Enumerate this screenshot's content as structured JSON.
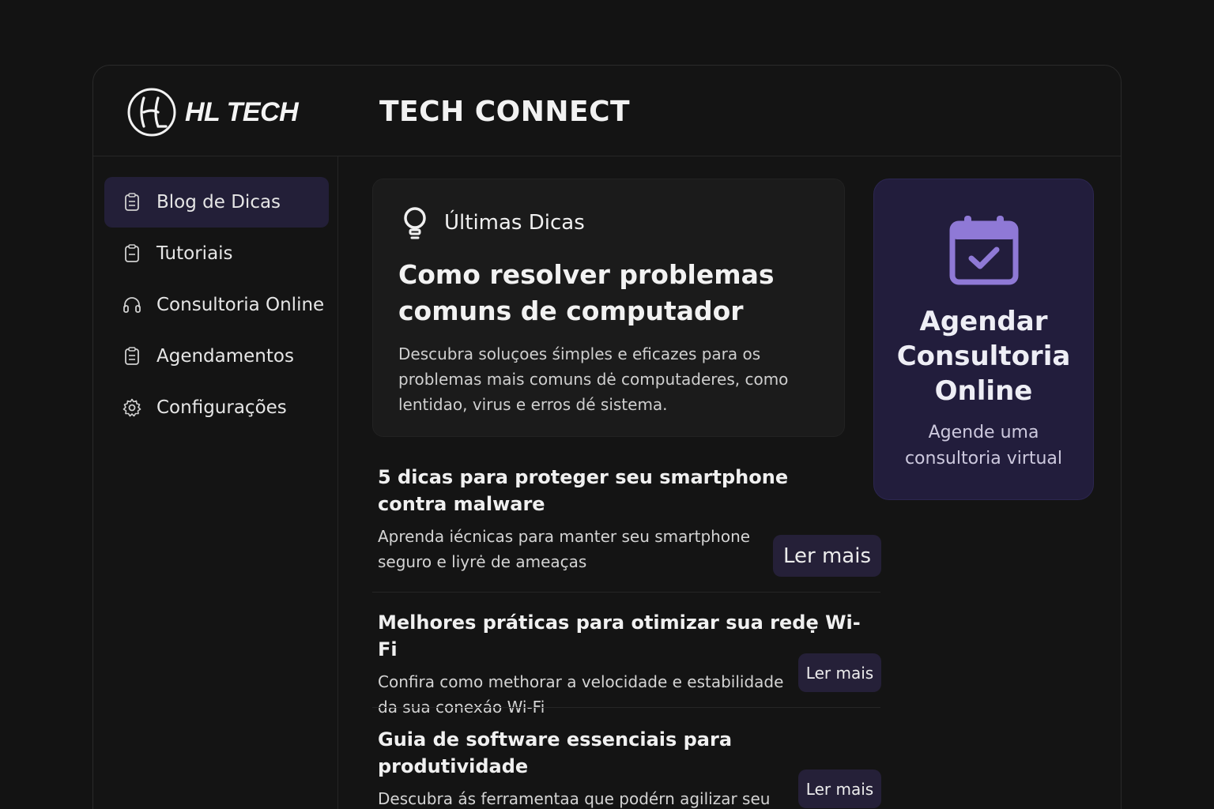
{
  "brand": {
    "name": "HL TECH",
    "monogram": "HL"
  },
  "app_title": "TECH CONNECT",
  "sidebar": {
    "items": [
      {
        "label": "Blog de Dicas",
        "icon": "clipboard-icon",
        "active": true
      },
      {
        "label": "Tutoriais",
        "icon": "clipboard-icon",
        "active": false
      },
      {
        "label": "Consultoria Online",
        "icon": "headset-icon",
        "active": false
      },
      {
        "label": "Agendamentos",
        "icon": "clipboard-icon",
        "active": false
      },
      {
        "label": "Configurações",
        "icon": "gear-icon",
        "active": false
      }
    ]
  },
  "featured": {
    "icon": "lightbulb-icon",
    "label": "Últimas Dicas",
    "title": "Como resolver problemas comuns de computador",
    "text": "Descubra soluçoes śimples e eficazes para os problemas mais comuns dė computaderes, como lentidao, virus e erros dé sistema."
  },
  "posts": [
    {
      "title": "5 dicas para proteger seu smartphone contra malware",
      "text": "Aprenda iécnicas para manter seu smartphone seguro e liyrė de ameaças",
      "button": "Ler mais"
    },
    {
      "title": "Melhores práticas para otimizar sua redẹ Wi-Fi",
      "text": "Confira como methorar a velocidade e estabilidade da sua conexáo Wi-Fi",
      "button": "Ler mais"
    },
    {
      "title": "Guia de software essenciais para produtividade",
      "text": "Descubra ás ferramentaa que podérn agilizar seu trabalho e aumentar sua eficiencia",
      "button": "Ler mais"
    }
  ],
  "cta": {
    "icon": "calendar-check-icon",
    "title": "Agendar Consultoria Online",
    "subtitle": "Agende uma consultoria virtual"
  },
  "colors": {
    "background": "#131313",
    "panel": "#141414",
    "card": "#1b1b1b",
    "active_nav": "#231f38",
    "cta_bg": "#221d3c",
    "button_bg": "#252038",
    "accent_purple": "#8f79d6"
  }
}
